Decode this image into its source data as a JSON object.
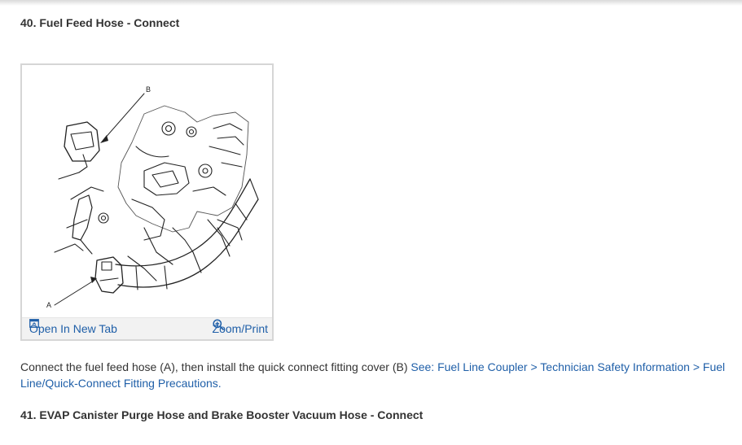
{
  "steps": [
    {
      "title": "40. Fuel Feed Hose - Connect",
      "figure": {
        "callouts": [
          "A",
          "B"
        ],
        "open_tab_label": "Open In New Tab",
        "zoom_label": "Zoom/Print",
        "open_tab_icon": "external-tab-icon",
        "zoom_icon": "magnifier-plus-icon"
      },
      "instruction_text": "Connect the fuel feed hose (A), then install the quick connect fitting cover (B) ",
      "link_text": "See: Fuel Line Coupler > Technician Safety Information > Fuel Line/Quick-Connect Fitting Precautions."
    },
    {
      "title": "41. EVAP Canister Purge Hose and Brake Booster Vacuum Hose - Connect"
    }
  ],
  "colors": {
    "link": "#1f5fa8",
    "text": "#333333",
    "toolbar_bg": "#f2f2f2",
    "figure_border": "#d6d6d6"
  }
}
